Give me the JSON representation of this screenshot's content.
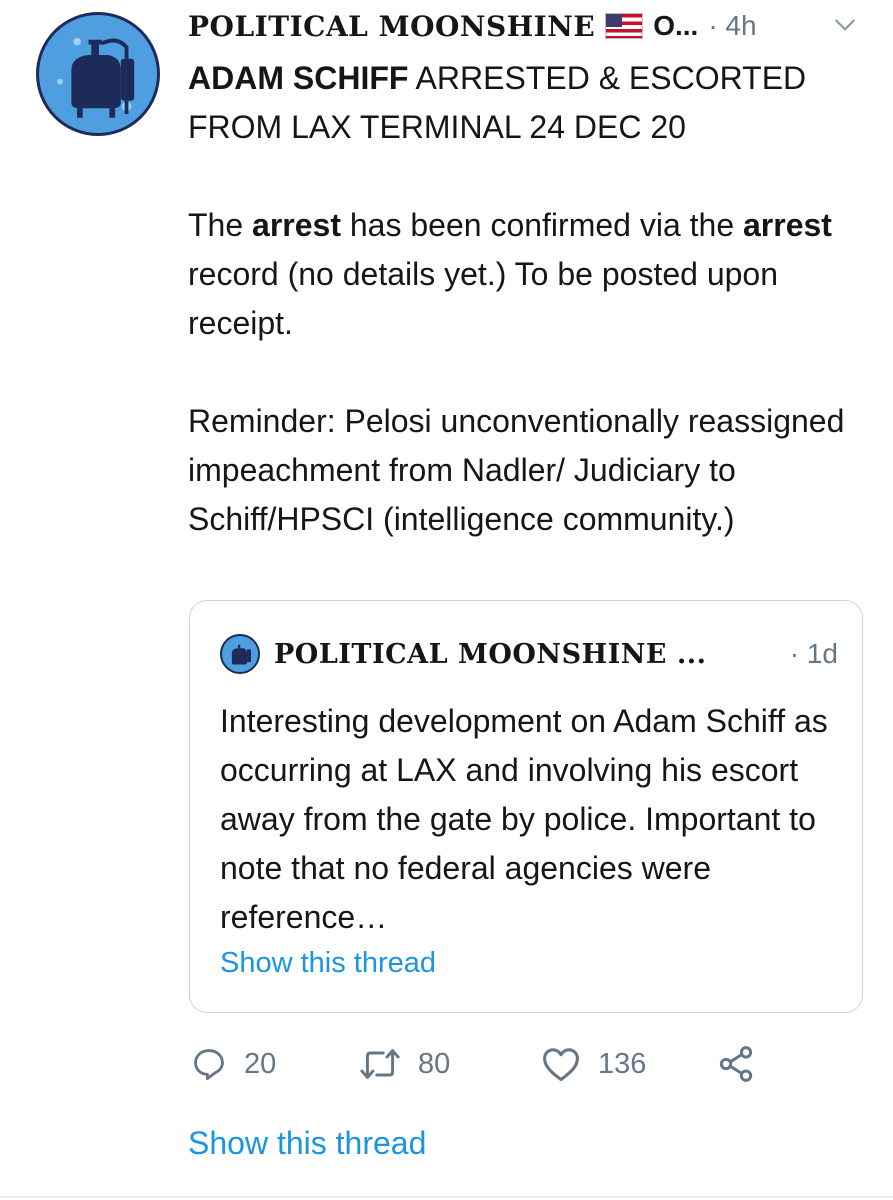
{
  "colors": {
    "link": "#1b95e0",
    "muted": "#657786",
    "text": "#14171a",
    "border": "#ccd6dd",
    "avatar_bg": "#4f9ee0"
  },
  "tweet": {
    "author_name": "POLITICAL MOONSHINE",
    "author_flag_icon": "us-flag-icon",
    "author_handle_truncated": "O...",
    "separator": "·",
    "time": "4h",
    "menu_icon": "chevron-down-icon",
    "headline_bold": "ADAM SCHIFF",
    "headline_rest": " ARRESTED & ESCORTED FROM LAX TERMINAL 24 DEC 20",
    "para1_a": "The ",
    "para1_bold1": "arrest",
    "para1_b": " has been confirmed via the ",
    "para1_bold2": "arrest",
    "para1_c": " record (no details yet.) To be posted upon receipt.",
    "para2": "Reminder: Pelosi unconventionally reassigned impeachment from Nadler/ Judiciary to Schiff/HPSCI (intelligence community.)"
  },
  "quote": {
    "author_name": "POLITICAL MOONSHINE ...",
    "separator": "·",
    "time": "1d",
    "text": "Interesting development on Adam Schiff as occurring at LAX and involving his escort away from the gate by police. Important to note that no federal agencies were reference…",
    "show_thread": "Show this thread"
  },
  "actions": {
    "reply_icon": "reply-icon",
    "reply_count": "20",
    "retweet_icon": "retweet-icon",
    "retweet_count": "80",
    "like_icon": "heart-icon",
    "like_count": "136",
    "share_icon": "share-icon"
  },
  "footer": {
    "show_thread": "Show this thread"
  }
}
